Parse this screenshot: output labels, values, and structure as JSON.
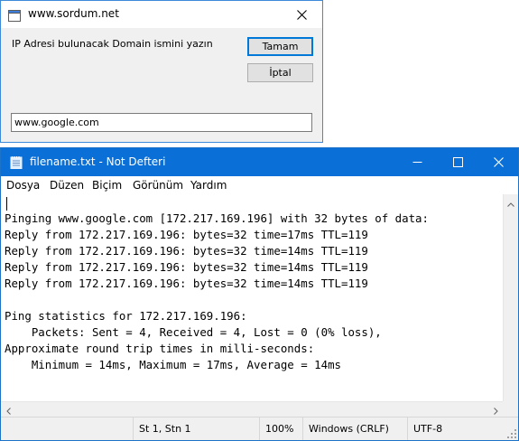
{
  "dialog": {
    "title": "www.sordum.net",
    "prompt": "IP Adresi bulunacak Domain ismini yazın",
    "ok_label": "Tamam",
    "cancel_label": "İptal",
    "input_value": "www.google.com",
    "icons": {
      "app": "app-window-icon",
      "close": "close-icon"
    }
  },
  "notepad": {
    "title": "filename.txt - Not Defteri",
    "menu": [
      {
        "label": "Dosya"
      },
      {
        "label": "Düzen"
      },
      {
        "label": "Biçim"
      },
      {
        "label": "Görünüm"
      },
      {
        "label": "Yardım"
      }
    ],
    "lines": [
      "",
      "Pinging www.google.com [172.217.169.196] with 32 bytes of data:",
      "Reply from 172.217.169.196: bytes=32 time=17ms TTL=119",
      "Reply from 172.217.169.196: bytes=32 time=14ms TTL=119",
      "Reply from 172.217.169.196: bytes=32 time=14ms TTL=119",
      "Reply from 172.217.169.196: bytes=32 time=14ms TTL=119",
      "",
      "Ping statistics for 172.217.169.196:",
      "    Packets: Sent = 4, Received = 4, Lost = 0 (0% loss),",
      "Approximate round trip times in milli-seconds:",
      "    Minimum = 14ms, Maximum = 17ms, Average = 14ms"
    ],
    "status": {
      "position": "St 1, Stn 1",
      "zoom": "100%",
      "line_ending": "Windows (CRLF)",
      "encoding": "UTF-8"
    },
    "icons": {
      "app": "notepad-icon",
      "minimize": "minimize-icon",
      "maximize": "maximize-icon",
      "close": "close-icon"
    },
    "colors": {
      "titlebar": "#0a6fd6",
      "accent": "#0078d7"
    }
  }
}
